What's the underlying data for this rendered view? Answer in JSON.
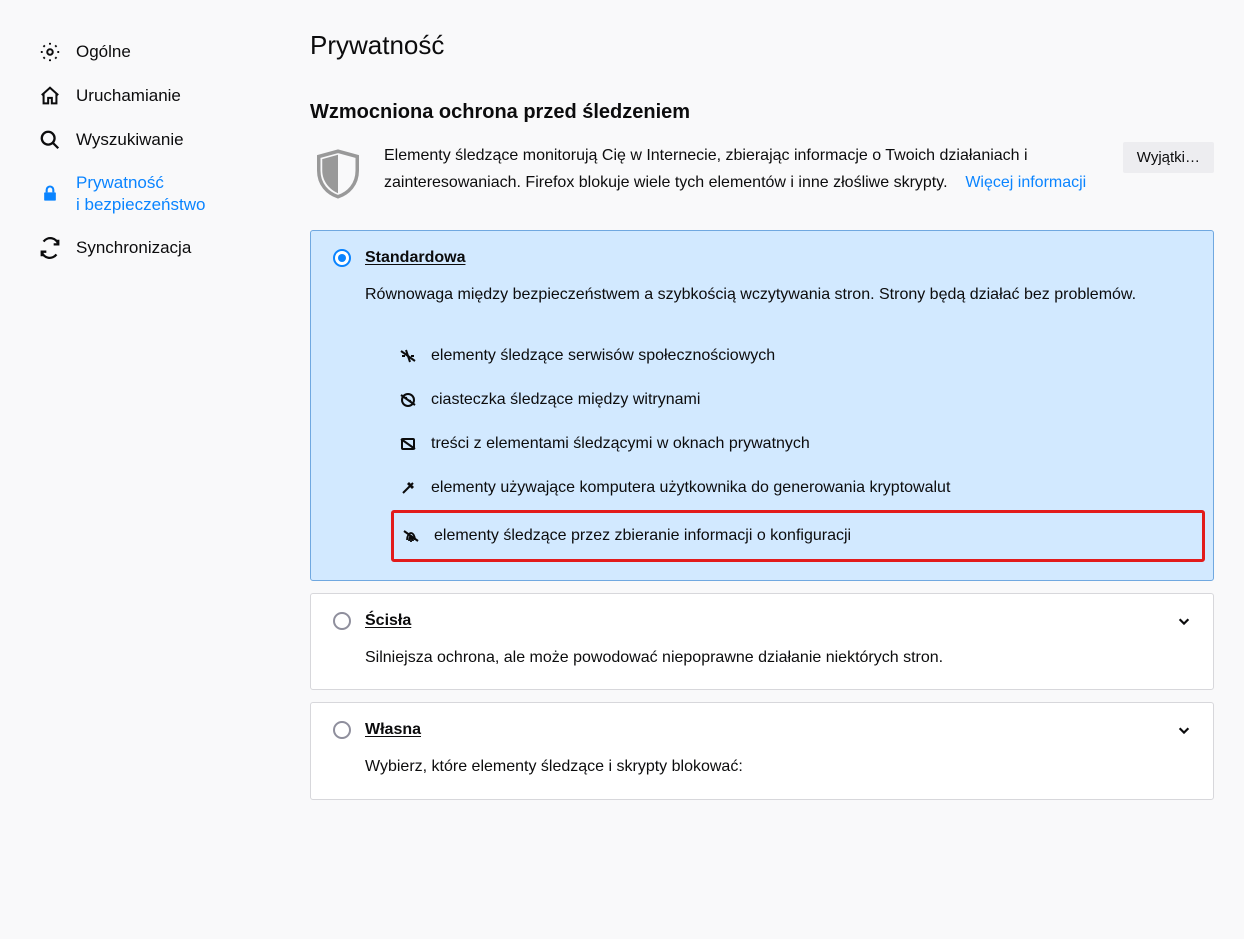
{
  "sidebar": {
    "items": [
      {
        "label": "Ogólne"
      },
      {
        "label": "Uruchamianie"
      },
      {
        "label": "Wyszukiwanie"
      },
      {
        "label": "Prywatność\ni bezpieczeństwo"
      },
      {
        "label": "Synchronizacja"
      }
    ]
  },
  "page": {
    "title": "Prywatność",
    "section_title": "Wzmocniona ochrona przed śledzeniem",
    "intro_text": "Elementy śledzące monitorują Cię w Internecie, zbierając informacje o Twoich działaniach i zainteresowaniach. Firefox blokuje wiele tych elementów i inne złośliwe skrypty.",
    "more_info": "Więcej informacji",
    "exceptions_btn": "Wyjątki…"
  },
  "options": {
    "standard": {
      "title": "Standardowa",
      "desc": "Równowaga między bezpieczeństwem a szybkością wczytywania stron. Strony będą działać bez problemów.",
      "bullets": [
        "elementy śledzące serwisów społecznościowych",
        "ciasteczka śledzące między witrynami",
        "treści z elementami śledzącymi w oknach prywatnych",
        "elementy używające komputera użytkownika do generowania kryptowalut",
        "elementy śledzące przez zbieranie informacji o konfiguracji"
      ]
    },
    "strict": {
      "title": "Ścisła",
      "desc": "Silniejsza ochrona, ale może powodować niepoprawne działanie niektórych stron."
    },
    "custom": {
      "title": "Własna",
      "desc": "Wybierz, które elementy śledzące i skrypty blokować:"
    }
  }
}
